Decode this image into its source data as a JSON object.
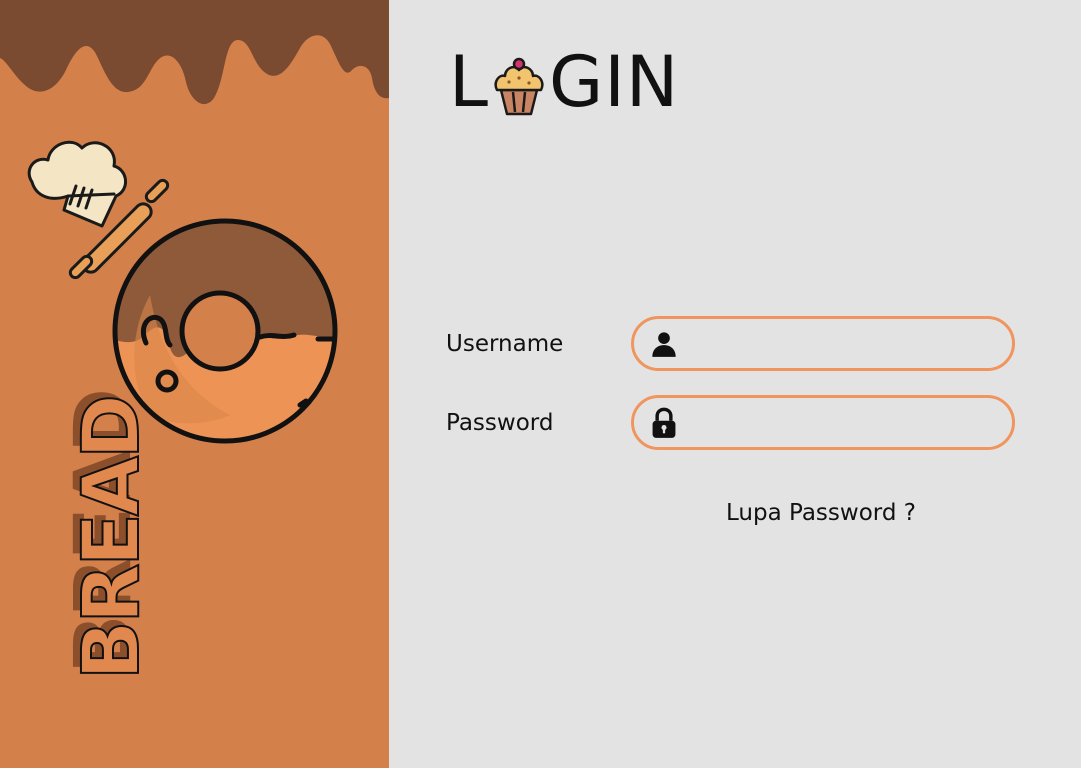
{
  "brand": {
    "name": "BREAD"
  },
  "login": {
    "title_prefix": "L",
    "title_suffix": "GIN"
  },
  "form": {
    "username_label": "Username",
    "username_value": "",
    "password_label": "Password",
    "password_value": "",
    "forgot_link": "Lupa Password ?"
  },
  "icons": {
    "username": "user-icon",
    "password": "lock-icon",
    "title": "cupcake-icon"
  },
  "colors": {
    "left_panel": "#d4804b",
    "drip": "#7a4b30",
    "right_panel": "#e3e3e3",
    "field_border": "#ef955d"
  }
}
